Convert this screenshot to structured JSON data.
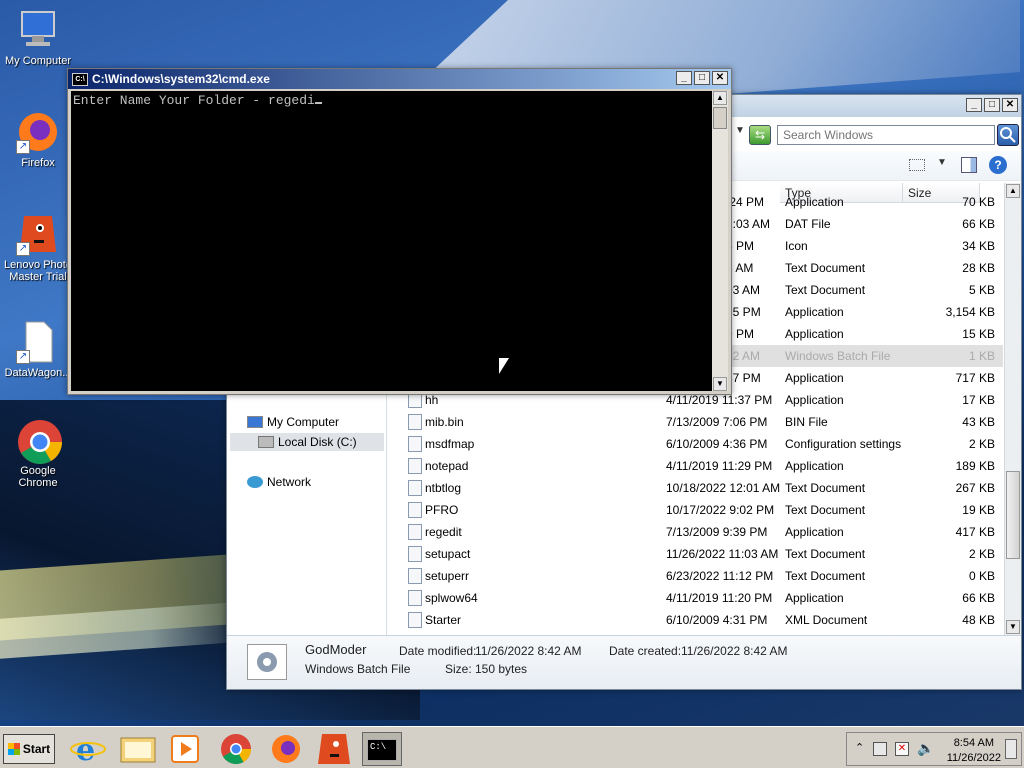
{
  "desktop": {
    "icons": [
      {
        "label": "My Computer",
        "icon": "computer-icon"
      },
      {
        "label": "Firefox",
        "icon": "firefox-icon"
      },
      {
        "label": "Lenovo Photo Master Trial",
        "icon": "lenovo-photo-master-icon"
      },
      {
        "label": "DataWagon...",
        "icon": "file-icon"
      },
      {
        "label": "Google Chrome",
        "icon": "chrome-icon"
      }
    ]
  },
  "cmd": {
    "title": "C:\\Windows\\system32\\cmd.exe",
    "prompt_text": "Enter Name Your Folder - regedi",
    "icon_text": "C:\\"
  },
  "explorer": {
    "search_placeholder": "Search Windows",
    "columns": {
      "type": "Type",
      "size": "Size"
    },
    "nav": {
      "my_computer": "My Computer",
      "local_disk": "Local Disk (C:)",
      "network": "Network"
    },
    "rows_partial": [
      {
        "date": "...:24 PM",
        "type": "Application",
        "size": "70 KB"
      },
      {
        "date": "...1:03 AM",
        "type": "DAT File",
        "size": "66 KB"
      },
      {
        "date": "...3 PM",
        "type": "Icon",
        "size": "34 KB"
      },
      {
        "date": "...3 AM",
        "type": "Text Document",
        "size": "28 KB"
      },
      {
        "date": "...03 AM",
        "type": "Text Document",
        "size": "5 KB"
      },
      {
        "date": "...35 PM",
        "type": "Application",
        "size": "3,154 KB"
      },
      {
        "date": "...9 PM",
        "type": "Application",
        "size": "15 KB"
      },
      {
        "date": "...42 AM",
        "type": "Windows Batch File",
        "size": "1 KB"
      },
      {
        "date": "...37 PM",
        "type": "Application",
        "size": "717 KB"
      }
    ],
    "rows": [
      {
        "name": "hh",
        "date": "4/11/2019 11:37 PM",
        "type": "Application",
        "size": "17 KB"
      },
      {
        "name": "mib.bin",
        "date": "7/13/2009 7:06 PM",
        "type": "BIN File",
        "size": "43 KB"
      },
      {
        "name": "msdfmap",
        "date": "6/10/2009 4:36 PM",
        "type": "Configuration settings",
        "size": "2 KB"
      },
      {
        "name": "notepad",
        "date": "4/11/2019 11:29 PM",
        "type": "Application",
        "size": "189 KB"
      },
      {
        "name": "ntbtlog",
        "date": "10/18/2022 12:01 AM",
        "type": "Text Document",
        "size": "267 KB"
      },
      {
        "name": "PFRO",
        "date": "10/17/2022 9:02 PM",
        "type": "Text Document",
        "size": "19 KB"
      },
      {
        "name": "regedit",
        "date": "7/13/2009 9:39 PM",
        "type": "Application",
        "size": "417 KB"
      },
      {
        "name": "setupact",
        "date": "11/26/2022 11:03 AM",
        "type": "Text Document",
        "size": "2 KB"
      },
      {
        "name": "setuperr",
        "date": "6/23/2022 11:12 PM",
        "type": "Text Document",
        "size": "0 KB"
      },
      {
        "name": "splwow64",
        "date": "4/11/2019 11:20 PM",
        "type": "Application",
        "size": "66 KB"
      },
      {
        "name": "Starter",
        "date": "6/10/2009 4:31 PM",
        "type": "XML Document",
        "size": "48 KB"
      }
    ],
    "details": {
      "name": "GodModer",
      "type": "Windows Batch File",
      "modified_label": "Date modified:",
      "modified": "11/26/2022 8:42 AM",
      "created_label": "Date created:",
      "created": "11/26/2022 8:42 AM",
      "size_label": "Size:",
      "size": "150 bytes"
    }
  },
  "taskbar": {
    "start_label": "Start",
    "time": "8:54 AM",
    "date": "11/26/2022"
  }
}
